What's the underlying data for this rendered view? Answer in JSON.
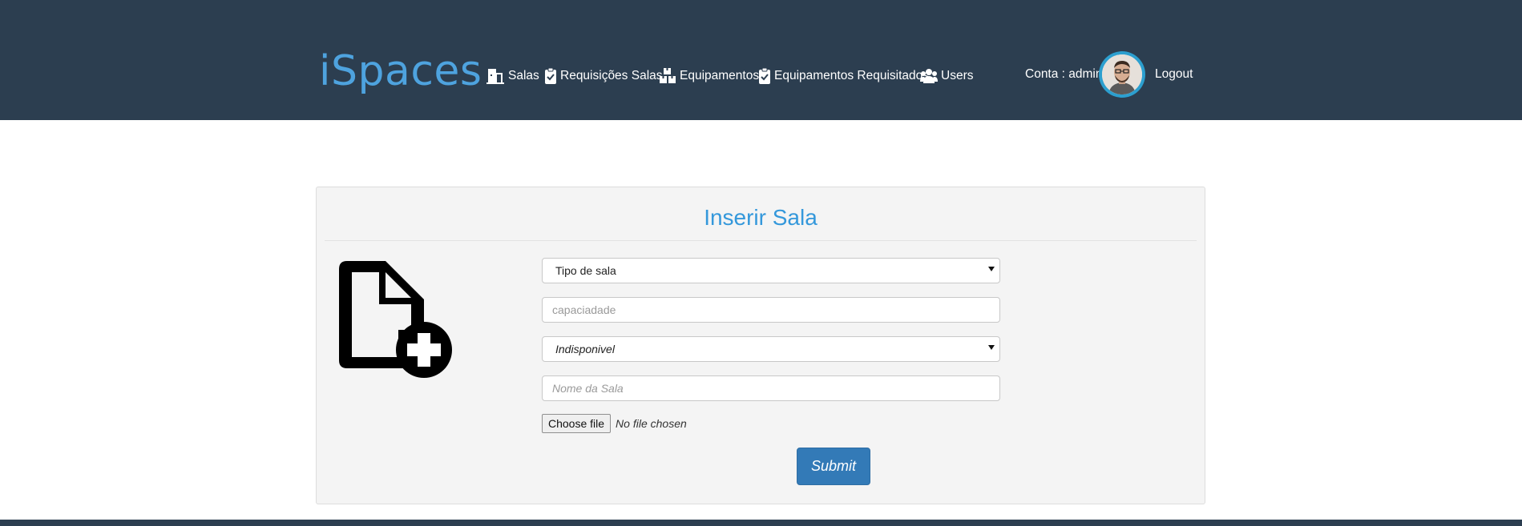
{
  "app": {
    "brand": "iSpaces",
    "colors": {
      "navbar": "#2c3e50",
      "brand": "#4ea3df",
      "title": "#3498db",
      "submit": "#337ab7"
    }
  },
  "nav": {
    "items": [
      {
        "label": "Salas",
        "icon": "building-door-icon"
      },
      {
        "label": "Requisições Salas",
        "icon": "clipboard-check-icon"
      },
      {
        "label": "Equipamentos",
        "icon": "boxes-icon"
      },
      {
        "label": "Equipamentos Requisitados",
        "icon": "clipboard-check-icon"
      },
      {
        "label": "Users",
        "icon": "users-icon"
      }
    ],
    "account_label": "Conta : admin",
    "logout_label": "Logout"
  },
  "form": {
    "title": "Inserir Sala",
    "icon": "file-add-icon",
    "tipo_sala": {
      "selected": "Tipo de sala"
    },
    "capacidade": {
      "placeholder": "capaciadade"
    },
    "estado": {
      "selected": "Indisponivel"
    },
    "nome": {
      "placeholder": "Nome da Sala"
    },
    "file": {
      "button_label": "Choose file",
      "status": "No file chosen"
    },
    "submit_label": "Submit"
  }
}
